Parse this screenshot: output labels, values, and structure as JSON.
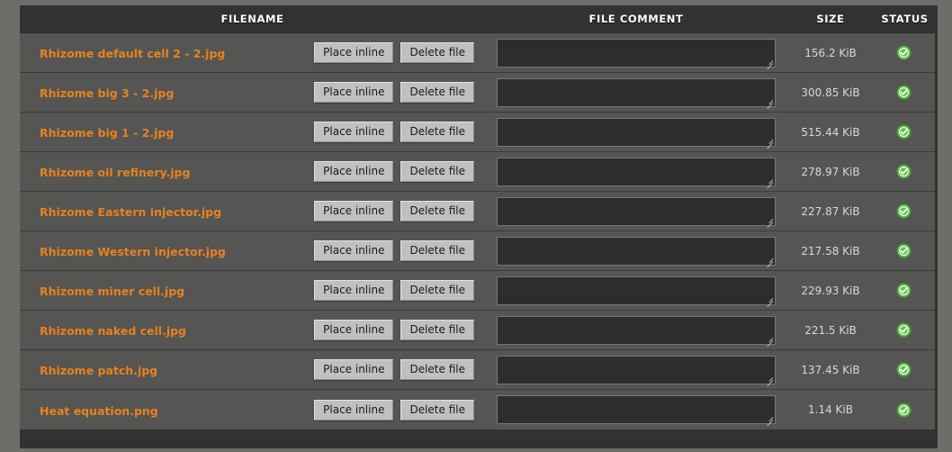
{
  "table": {
    "columns": {
      "filename": "FILENAME",
      "file_comment": "FILE COMMENT",
      "size": "SIZE",
      "status": "STATUS"
    },
    "buttons": {
      "place_inline": "Place inline",
      "delete_file": "Delete file"
    },
    "comment_placeholder": "",
    "status_icon": "green-check-circle-icon",
    "colors": {
      "link": "#e8821e",
      "row_bg": "#555553",
      "header_bg": "#323232",
      "page_bg": "#6d6d6a",
      "status_ok": "#5aba47",
      "button_bg": "#c0c0c0",
      "textarea_bg": "#2d2d2d"
    },
    "rows": [
      {
        "filename": "Rhizome default cell 2 - 2.jpg",
        "comment": "",
        "size": "156.2 KiB",
        "status": "ok"
      },
      {
        "filename": "Rhizome big 3 - 2.jpg",
        "comment": "",
        "size": "300.85 KiB",
        "status": "ok"
      },
      {
        "filename": "Rhizome big 1 - 2.jpg",
        "comment": "",
        "size": "515.44 KiB",
        "status": "ok"
      },
      {
        "filename": "Rhizome oil refinery.jpg",
        "comment": "",
        "size": "278.97 KiB",
        "status": "ok"
      },
      {
        "filename": "Rhizome Eastern injector.jpg",
        "comment": "",
        "size": "227.87 KiB",
        "status": "ok"
      },
      {
        "filename": "Rhizome Western injector.jpg",
        "comment": "",
        "size": "217.58 KiB",
        "status": "ok"
      },
      {
        "filename": "Rhizome miner cell.jpg",
        "comment": "",
        "size": "229.93 KiB",
        "status": "ok"
      },
      {
        "filename": "Rhizome naked cell.jpg",
        "comment": "",
        "size": "221.5 KiB",
        "status": "ok"
      },
      {
        "filename": "Rhizome patch.jpg",
        "comment": "",
        "size": "137.45 KiB",
        "status": "ok"
      },
      {
        "filename": "Heat equation.png",
        "comment": "",
        "size": "1.14 KiB",
        "status": "ok"
      }
    ]
  }
}
